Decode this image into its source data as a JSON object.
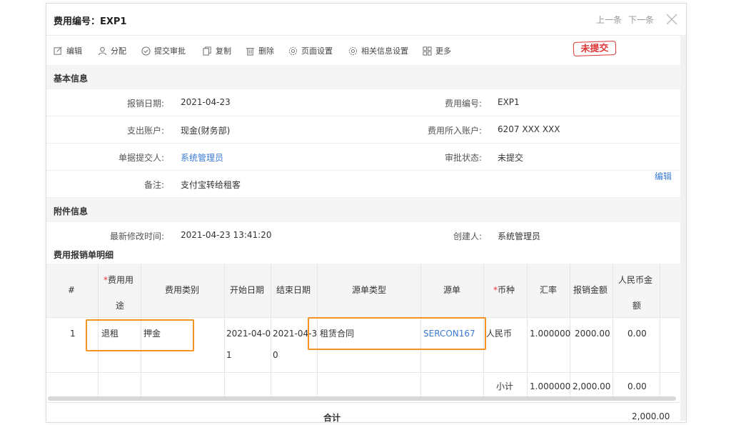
{
  "header": {
    "title": "费用编号：EXP1",
    "prev_label": "上一条",
    "next_label": "下一条"
  },
  "toolbar": {
    "edit": "编辑",
    "assign": "分配",
    "submit": "提交审批",
    "copy": "复制",
    "delete": "删除",
    "page_settings": "页面设置",
    "related_settings": "相关信息设置",
    "more": "更多"
  },
  "status_stamp": "未提交",
  "basic_info": {
    "title": "基本信息",
    "report_date_label": "报销日期:",
    "report_date": "2021-04-23",
    "expense_no_label": "费用编号:",
    "expense_no": "EXP1",
    "pay_account_label": "支出账户:",
    "pay_account": "现金(财务部)",
    "expense_account_label": "费用所入账户:",
    "expense_account": "6207 XXX XXX",
    "submitter_label": "单据提交人:",
    "submitter": "系统管理员",
    "approval_status_label": "审批状态:",
    "approval_status": "未提交",
    "remark_label": "备注:",
    "remark": "支付宝转给租客",
    "edit_link": "编辑"
  },
  "attachment_info": {
    "title": "附件信息",
    "modified_label": "最新修改时间:",
    "modified": "2021-04-23 13:41:20",
    "creator_label": "创建人:",
    "creator": "系统管理员"
  },
  "detail": {
    "title": "费用报销单明细",
    "headers": {
      "index": "#",
      "usage_line1": "费用用",
      "usage_line2": "途",
      "category": "费用类别",
      "start_date": "开始日期",
      "end_date": "结束日期",
      "source_type": "源单类型",
      "source": "源单",
      "currency": "币种",
      "rate": "汇率",
      "amount": "报销金额",
      "rmb_line1": "人民币金",
      "rmb_line2": "额",
      "required_mark": "*"
    },
    "row": {
      "index": "1",
      "usage": "退租",
      "category": "押金",
      "start_line1": "2021-04-0",
      "start_line2": "1",
      "end_line1": "2021-04-3",
      "end_line2": "0",
      "source_type": "租赁合同",
      "source": "SERCON167",
      "currency": "人民币",
      "rate": "1.000000",
      "amount": "2000.00",
      "rmb": "0.00"
    },
    "subtotal": {
      "label": "小计",
      "rate": "1.000000",
      "amount": "2,000.00",
      "rmb": "0.00"
    },
    "total": {
      "label": "合计",
      "value": "2,000.00"
    }
  },
  "colors": {
    "link": "#3a7bd5",
    "highlight": "#f39321",
    "stamp": "#dd3333"
  }
}
